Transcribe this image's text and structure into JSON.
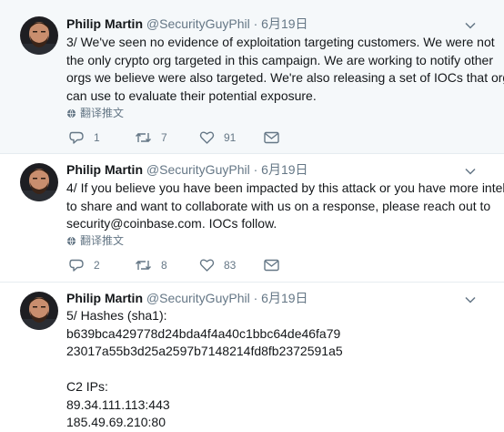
{
  "tweets": [
    {
      "name": "Philip Martin",
      "handle": "@SecurityGuyPhil",
      "dot": "·",
      "date": "6月19日",
      "lines": [
        "3/ We've seen no evidence of exploitation targeting customers.  We were not",
        "the only crypto org targeted in this campaign. We are working to notify other",
        "orgs we believe were also targeted. We're also releasing a set of IOCs that orgs",
        "can use to evaluate their potential exposure."
      ],
      "translate": "翻译推文",
      "replies": "1",
      "retweets": "7",
      "likes": "91"
    },
    {
      "name": "Philip Martin",
      "handle": "@SecurityGuyPhil",
      "dot": "·",
      "date": "6月19日",
      "lines": [
        "4/ If you believe you have been impacted by this attack or you have more intel",
        "to share and want to collaborate with us on a response, please reach out to",
        "security@coinbase.com.  IOCs follow."
      ],
      "translate": "翻译推文",
      "replies": "2",
      "retweets": "8",
      "likes": "83"
    },
    {
      "name": "Philip Martin",
      "handle": "@SecurityGuyPhil",
      "dot": "·",
      "date": "6月19日",
      "lines": [
        "5/ Hashes (sha1):",
        "b639bca429778d24bda4f4a40c1bbc64de46fa79",
        "23017a55b3d25a2597b7148214fd8fb2372591a5",
        "",
        "C2 IPs:",
        "89.34.111.113:443",
        "185.49.69.210:80"
      ]
    }
  ],
  "colors": {
    "highlight_bg": "#f5f8fa",
    "text": "#14171a",
    "muted": "#657786",
    "divider": "#e6ecf0"
  },
  "icons": [
    "chevron-down-icon",
    "globe-icon",
    "reply-icon",
    "retweet-icon",
    "like-icon",
    "dm-icon"
  ]
}
